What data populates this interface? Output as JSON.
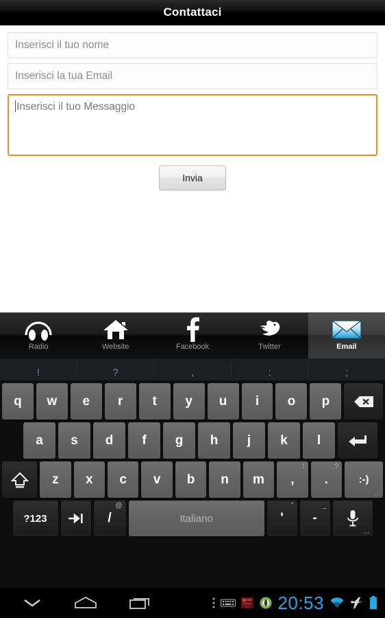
{
  "header": {
    "title": "Contattaci"
  },
  "form": {
    "name_placeholder": "Inserisci il tuo nome",
    "email_placeholder": "Inserisci la tua Email",
    "message_placeholder": "Inserisci il tuo Messaggio",
    "submit_label": "Invia",
    "focus_color": "#e9911f"
  },
  "tabs": [
    {
      "label": "Radio",
      "icon": "headphones-icon",
      "active": false
    },
    {
      "label": "Website",
      "icon": "home-icon",
      "active": false
    },
    {
      "label": "Facebook",
      "icon": "facebook-icon",
      "active": false
    },
    {
      "label": "Twitter",
      "icon": "twitter-bird-icon",
      "active": false
    },
    {
      "label": "Email",
      "icon": "envelope-icon",
      "active": true
    }
  ],
  "keyboard": {
    "suggestions": [
      "!",
      "?",
      ",",
      ":",
      ";"
    ],
    "row1": [
      "q",
      "w",
      "e",
      "r",
      "t",
      "y",
      "u",
      "i",
      "o",
      "p"
    ],
    "row1_action": "backspace-icon",
    "row2": [
      "a",
      "s",
      "d",
      "f",
      "g",
      "h",
      "j",
      "k",
      "l"
    ],
    "row2_action": "enter-icon",
    "row3_shift": "shift-icon",
    "row3": [
      "z",
      "x",
      "c",
      "v",
      "b",
      "n",
      "m"
    ],
    "row3_comma": {
      "main": ",",
      "sup": "!"
    },
    "row3_period": {
      "main": ".",
      "sup": "?"
    },
    "row3_emoji": ":-)",
    "row4": {
      "symbols": "?123",
      "tab": "tab-icon",
      "slash": {
        "main": "/",
        "sup": "@"
      },
      "space": "Italiano",
      "apostrophe": {
        "main": "'",
        "sup": "\""
      },
      "dash": {
        "main": "-",
        "sup": "_"
      },
      "mic": "microphone-icon"
    }
  },
  "navbar": {
    "back": "chevron-down-icon",
    "home": "home-outline-icon",
    "recents": "recent-apps-icon",
    "more": "overflow-dots-icon",
    "keyboard_indicator": "keyboard-icon",
    "notification_1": "app-notification-icon",
    "notification_2": "app-notification-icon",
    "clock": "20:53",
    "wifi": "wifi-icon",
    "airplane": "airplane-mode-icon",
    "battery": "battery-icon",
    "accent_color": "#29a6e0"
  }
}
